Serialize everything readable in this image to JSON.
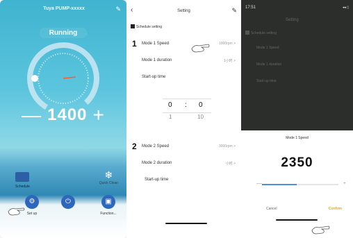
{
  "panel1": {
    "device_name": "Tuya PUMP-xxxxx",
    "status": "Running",
    "speed_value": "1400",
    "minus_label": "—",
    "plus_label": "+",
    "schedule_label": "Schedule",
    "quick_clean_label": "Quick Clean",
    "buttons": [
      {
        "label": "Set up",
        "icon": "gear-icon"
      },
      {
        "label": "",
        "icon": "power-icon"
      },
      {
        "label": "Function...",
        "icon": "function-icon"
      }
    ],
    "colors": {
      "button": "#2d67bd",
      "gauge_ring": "#cde8f3",
      "needle": "#ff5a2a"
    }
  },
  "panel2": {
    "title": "Setting",
    "schedule_setting": "Schedule setting",
    "mode1": {
      "number": "1",
      "speed_label": "Mode 1 Speed",
      "speed_value": "1000rpm >",
      "duration_label": "Mode 1 duration",
      "duration_value": "1小时 >",
      "startup_label": "Start-up time"
    },
    "picker": {
      "hour": "0",
      "colon": ":",
      "minute": "0",
      "next_hour": "1",
      "next_minute": "10"
    },
    "mode2": {
      "number": "2",
      "speed_label": "Mode 2 Speed",
      "speed_value": "3000rpm >",
      "duration_label": "Mode 2 duration",
      "duration_value": "小时 >",
      "startup_label": "Start-up time"
    }
  },
  "panel3": {
    "status_time": "17:51",
    "status_icons": "◂◂ ▯",
    "bg_title": "Setting",
    "bg_schedule": "Schedule setting",
    "bg_mode1_speed": "Mode 1 Speed",
    "bg_mode1_duration": "Mode 1 duration",
    "bg_startup": "Start-up time",
    "sheet_title": "Mode 1 Speed",
    "speed_value": "2350",
    "slider_fraction": 0.45,
    "minus_label": "—",
    "plus_label": "+",
    "cancel_label": "Cancel",
    "confirm_label": "Confirm",
    "colors": {
      "confirm": "#f0a800",
      "slider": "#4a90d6"
    }
  }
}
